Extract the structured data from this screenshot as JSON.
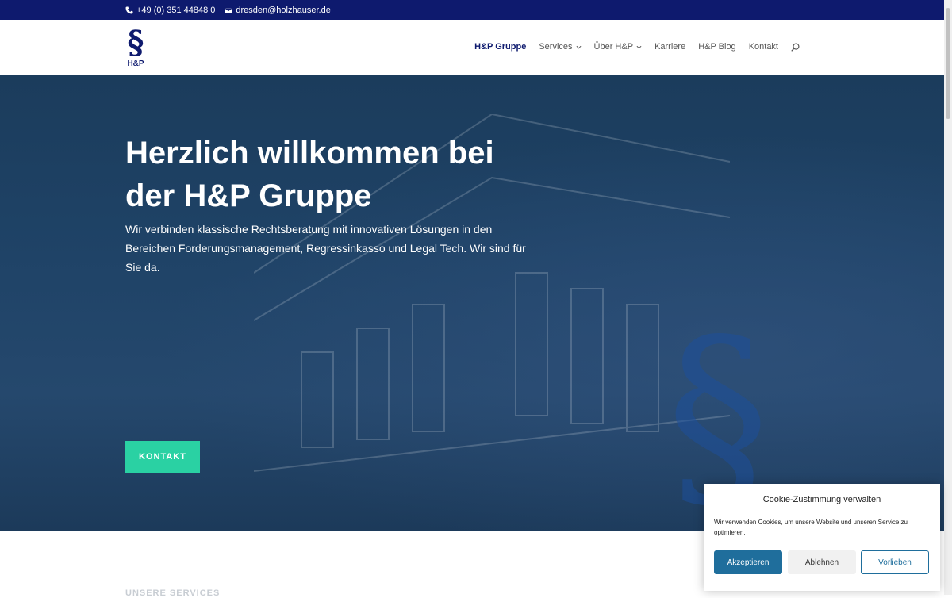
{
  "topbar": {
    "phone": "+49 (0) 351 44848 0",
    "email": "dresden@holzhauser.de"
  },
  "logo": {
    "text": "H&P"
  },
  "nav": {
    "items": [
      {
        "label": "H&P Gruppe",
        "active": true
      },
      {
        "label": "Services"
      },
      {
        "label": "Über H&P"
      },
      {
        "label": "Karriere"
      },
      {
        "label": "H&P Blog"
      },
      {
        "label": "Kontakt"
      }
    ]
  },
  "hero": {
    "title_line1": "Herzlich willkommen bei",
    "title_line2": "der H&P Gruppe",
    "text": "Wir verbinden klassische Rechtsberatung mit innovativen Lösungen in den Bereichen Forderungsmanagement, Regressinkasso und Legal Tech. Wir sind für Sie da.",
    "button": "KONTAKT"
  },
  "section": {
    "label": "UNSERE SERVICES"
  },
  "cookie": {
    "title": "Cookie-Zustimmung verwalten",
    "message": "Wir verwenden Cookies, um unsere Website und unseren Service zu optimieren.",
    "accept": "Akzeptieren",
    "deny": "Ablehnen",
    "preferences": "Vorlieben"
  },
  "colors": {
    "topbar": "#0e1a6e",
    "accent_button": "#2ad1a3",
    "cookie_accent": "#1f6e9c"
  }
}
